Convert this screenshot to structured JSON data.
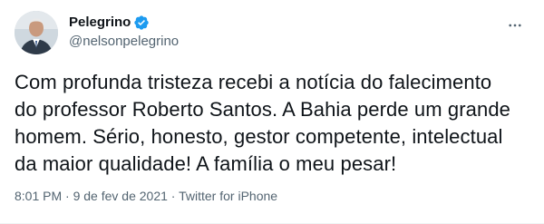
{
  "author": {
    "display_name": "Pelegrino",
    "handle": "@nelsonpelegrino",
    "verified_icon": "verified-badge-icon",
    "verified_color": "#1d9bf0"
  },
  "tweet": {
    "text": "Com profunda tristeza recebi a notícia do falecimento\ndo professor Roberto Santos. A Bahia perde um grande\nhomem. Sério, honesto, gestor competente, intelectual\nda maior qualidade! A família o meu pesar!"
  },
  "meta": {
    "time": "8:01 PM",
    "separator": " · ",
    "date": "9 de fev de 2021",
    "source": "Twitter for iPhone"
  },
  "icons": {
    "more": "more-options-icon"
  },
  "colors": {
    "text_primary": "#0f1419",
    "text_secondary": "#536471",
    "accent": "#1d9bf0"
  }
}
